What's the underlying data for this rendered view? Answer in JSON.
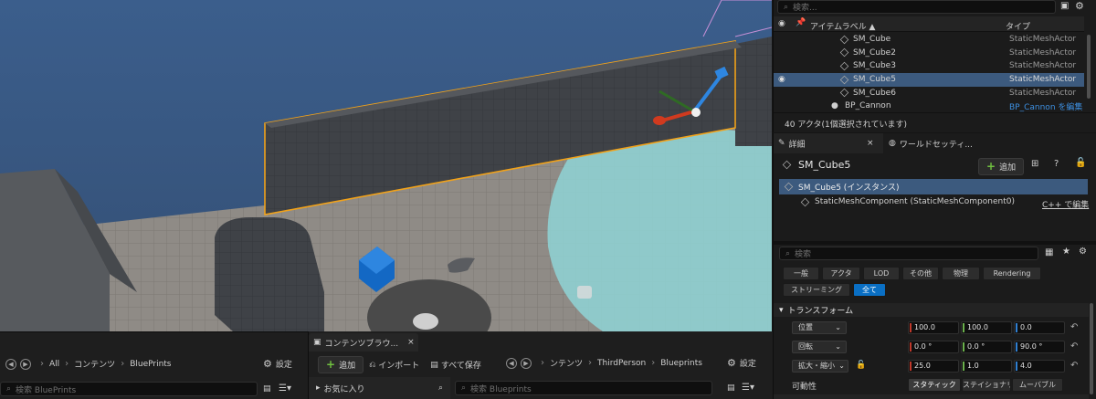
{
  "outliner": {
    "search_placeholder": "検索...",
    "col_label": "アイテムラベル ▲",
    "col_type": "タイプ",
    "rows": [
      {
        "name": "SM_Cube",
        "type": "StaticMeshActor"
      },
      {
        "name": "SM_Cube2",
        "type": "StaticMeshActor"
      },
      {
        "name": "SM_Cube3",
        "type": "StaticMeshActor"
      },
      {
        "name": "SM_Cube5",
        "type": "StaticMeshActor"
      },
      {
        "name": "SM_Cube6",
        "type": "StaticMeshActor"
      },
      {
        "name": "BP_Cannon",
        "type": "BP_Cannon を編集"
      }
    ],
    "status": "40 アクタ(1個選択されています)"
  },
  "details": {
    "tab_details": "詳細",
    "tab_world": "ワールドセッティ...",
    "actor_name": "SM_Cube5",
    "add_label": "追加",
    "instance_label": "SM_Cube5 (インスタンス)",
    "component_label": "StaticMeshComponent (StaticMeshComponent0)",
    "cpp_edit": "C++ で編集",
    "search_placeholder": "検索",
    "filters": [
      "一般",
      "アクタ",
      "LOD",
      "その他",
      "物理",
      "Rendering",
      "ストリーミング",
      "全て"
    ],
    "transform_header": "トランスフォーム",
    "location_label": "位置",
    "rotation_label": "回転",
    "scale_label": "拡大・縮小",
    "location": [
      "100.0",
      "100.0",
      "0.0"
    ],
    "rotation": [
      "0.0 °",
      "0.0 °",
      "90.0 °"
    ],
    "scale": [
      "25.0",
      "1.0",
      "4.0"
    ],
    "mobility_label": "可動性",
    "mobility_options": [
      "スタティック",
      "ステイショナリ",
      "ムーバブル"
    ]
  },
  "content_left": {
    "path": [
      "All",
      "コンテンツ",
      "BluePrints"
    ],
    "settings": "設定",
    "search_placeholder": "検索 BluePrints"
  },
  "content_browser": {
    "tab_label": "コンテンツブラウ...",
    "add_label": "追加",
    "import_label": "インポート",
    "save_all_label": "すべて保存",
    "path": [
      "ンテンツ",
      "ThirdPerson",
      "Blueprints"
    ],
    "settings": "設定",
    "favorites_label": "お気に入り",
    "search_placeholder": "検索 Blueprints"
  }
}
